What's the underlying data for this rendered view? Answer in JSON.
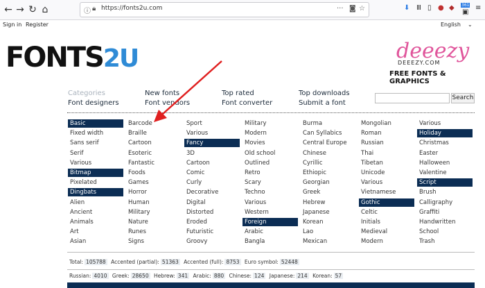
{
  "browser": {
    "url": "https://fonts2u.com",
    "nav_back": "←",
    "nav_forward": "→",
    "nav_reload": "↻",
    "nav_home": "⌂",
    "more_actions": "···",
    "badge_count": "361"
  },
  "top_menu": {
    "sign_in": "Sign in",
    "register": "Register",
    "language": "English"
  },
  "logo": {
    "main": "FONTS",
    "suffix": "2U"
  },
  "ad": {
    "brand": "deeezy",
    "domain": "DEEEZY.COM",
    "tagline": "FREE FONTS & GRAPHICS"
  },
  "nav": {
    "categories": "Categories",
    "font_designers": "Font designers",
    "new_fonts": "New fonts",
    "font_vendors": "Font vendors",
    "top_rated": "Top rated",
    "font_converter": "Font converter",
    "top_downloads": "Top downloads",
    "submit_font": "Submit a font",
    "search_button": "Search"
  },
  "categories": [
    [
      "Basic",
      "Fixed width",
      "Sans serif",
      "Serif",
      "Various",
      "Bitmap",
      "Pixelated",
      "Dingbats",
      "Alien",
      "Ancient",
      "Animals",
      "Art",
      "Asian"
    ],
    [
      "Barcode",
      "Braille",
      "Cartoon",
      "Esoteric",
      "Fantastic",
      "Foods",
      "Games",
      "Horror",
      "Human",
      "Military",
      "Nature",
      "Runes",
      "Signs"
    ],
    [
      "Sport",
      "Various",
      "Fancy",
      "3D",
      "Cartoon",
      "Comic",
      "Curly",
      "Decorative",
      "Digital",
      "Distorted",
      "Eroded",
      "Futuristic",
      "Groovy"
    ],
    [
      "Military",
      "Modern",
      "Movies",
      "Old school",
      "Outlined",
      "Retro",
      "Scary",
      "Techno",
      "Various",
      "Western",
      "Foreign",
      "Arabic",
      "Bangla"
    ],
    [
      "Burma",
      "Can Syllabics",
      "Central Europe",
      "Chinese",
      "Cyrillic",
      "Ethiopic",
      "Georgian",
      "Greek",
      "Hebrew",
      "Japanese",
      "Korean",
      "Lao",
      "Mexican"
    ],
    [
      "Mongolian",
      "Roman",
      "Russian",
      "Thai",
      "Tibetan",
      "Unicode",
      "Various",
      "Vietnamese",
      "Gothic",
      "Celtic",
      "Initials",
      "Medieval",
      "Modern"
    ],
    [
      "Various",
      "Holiday",
      "Christmas",
      "Easter",
      "Halloween",
      "Valentine",
      "Script",
      "Brush",
      "Calligraphy",
      "Graffiti",
      "Handwritten",
      "School",
      "Trash"
    ]
  ],
  "stats1": {
    "total_label": "Total:",
    "total": "105788",
    "accented_partial_label": "Accented (partial):",
    "accented_partial": "51363",
    "accented_full_label": "Accented (full):",
    "accented_full": "8753",
    "euro_label": "Euro symbol:",
    "euro": "52448"
  },
  "stats2": {
    "russian_label": "Russian:",
    "russian": "4010",
    "greek_label": "Greek:",
    "greek": "28650",
    "hebrew_label": "Hebrew:",
    "hebrew": "341",
    "arabic_label": "Arabic:",
    "arabic": "880",
    "chinese_label": "Chinese:",
    "chinese": "124",
    "japanese_label": "Japanese:",
    "japanese": "214",
    "korean_label": "Korean:",
    "korean": "57"
  },
  "colors": {
    "highlight": "#0b2d54",
    "logo_accent": "#2f8bd6",
    "ad_pink": "#e0559b",
    "arrow": "#e02020"
  }
}
